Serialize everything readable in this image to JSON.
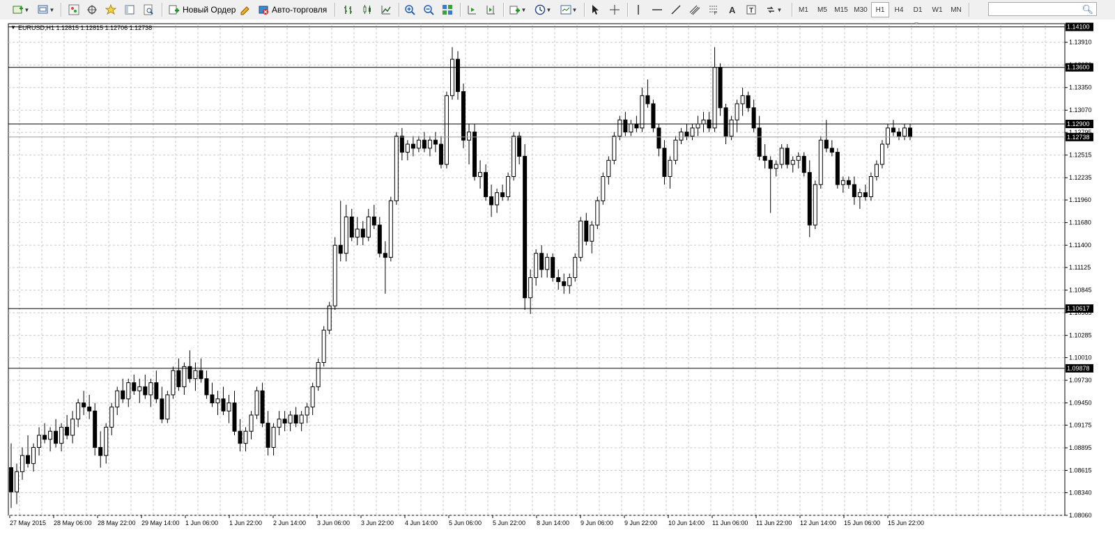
{
  "toolbar": {
    "new_order_label": "Новый Ордер",
    "auto_trading_label": "Авто-торговля",
    "timeframes": [
      "M1",
      "M5",
      "M15",
      "M30",
      "H1",
      "H4",
      "D1",
      "W1",
      "MN"
    ],
    "active_timeframe": "H1",
    "search_placeholder": ""
  },
  "chart_data": {
    "type": "candlestick",
    "symbol_header": "EURUSD,H1  1.12815 1.12815 1.12706 1.12738",
    "price_ticks": [
      "1.13910",
      "1.13630",
      "1.13350",
      "1.13070",
      "1.12795",
      "1.12515",
      "1.12235",
      "1.11960",
      "1.11680",
      "1.11400",
      "1.11125",
      "1.10845",
      "1.10565",
      "1.10285",
      "1.10010",
      "1.09730",
      "1.09450",
      "1.09175",
      "1.08895",
      "1.08615",
      "1.08340",
      "1.08060"
    ],
    "time_ticks": [
      "27 May 2015",
      "28 May 06:00",
      "28 May 22:00",
      "29 May 14:00",
      "1 Jun 06:00",
      "1 Jun 22:00",
      "2 Jun 14:00",
      "3 Jun 06:00",
      "3 Jun 22:00",
      "4 Jun 14:00",
      "5 Jun 06:00",
      "5 Jun 22:00",
      "8 Jun 14:00",
      "9 Jun 06:00",
      "9 Jun 22:00",
      "10 Jun 14:00",
      "11 Jun 06:00",
      "11 Jun 22:00",
      "12 Jun 14:00",
      "15 Jun 06:00",
      "15 Jun 22:00"
    ],
    "y_range": [
      1.0806,
      1.1414
    ],
    "levels": [
      {
        "price": 1.141,
        "label": "1.14100"
      },
      {
        "price": 1.136,
        "label": "1.13600"
      },
      {
        "price": 1.129,
        "label": "1.12900"
      },
      {
        "price": 1.10617,
        "label": "1.10617"
      },
      {
        "price": 1.09878,
        "label": "1.09878"
      }
    ],
    "current_price": {
      "price": 1.12738,
      "label": "1.12738"
    },
    "grid": true,
    "candles": [
      [
        1.0865,
        1.0895,
        1.0815,
        1.0835
      ],
      [
        1.0835,
        1.087,
        1.082,
        1.086
      ],
      [
        1.086,
        1.089,
        1.085,
        1.088
      ],
      [
        1.088,
        1.0905,
        1.0865,
        1.087
      ],
      [
        1.087,
        1.0895,
        1.086,
        1.089
      ],
      [
        1.089,
        1.0915,
        1.088,
        1.0905
      ],
      [
        1.0905,
        1.092,
        1.0895,
        1.09
      ],
      [
        1.09,
        1.0915,
        1.0885,
        1.091
      ],
      [
        1.091,
        1.0925,
        1.089,
        1.0895
      ],
      [
        1.0895,
        1.092,
        1.0885,
        1.0915
      ],
      [
        1.0915,
        1.093,
        1.09,
        1.0905
      ],
      [
        1.0905,
        1.0935,
        1.0895,
        1.0925
      ],
      [
        1.0925,
        1.095,
        1.0915,
        1.0945
      ],
      [
        1.0945,
        1.096,
        1.093,
        1.094
      ],
      [
        1.094,
        1.0955,
        1.0925,
        1.0935
      ],
      [
        1.0935,
        1.0945,
        1.088,
        1.089
      ],
      [
        1.089,
        1.091,
        1.0865,
        1.088
      ],
      [
        1.088,
        1.092,
        1.087,
        1.0915
      ],
      [
        1.0915,
        1.0945,
        1.0905,
        1.094
      ],
      [
        1.094,
        1.0965,
        1.093,
        1.096
      ],
      [
        1.096,
        1.0975,
        1.0945,
        1.095
      ],
      [
        1.095,
        1.0975,
        1.094,
        1.097
      ],
      [
        1.097,
        1.098,
        1.0955,
        1.096
      ],
      [
        1.096,
        1.0975,
        1.0945,
        1.0965
      ],
      [
        1.0965,
        1.098,
        1.095,
        1.0955
      ],
      [
        1.0955,
        1.0975,
        1.094,
        1.097
      ],
      [
        1.097,
        1.0985,
        1.0945,
        1.095
      ],
      [
        1.095,
        1.0965,
        1.092,
        1.0925
      ],
      [
        1.0925,
        1.096,
        1.092,
        1.0955
      ],
      [
        1.0955,
        1.099,
        1.095,
        1.0985
      ],
      [
        1.0985,
        1.1,
        1.096,
        1.0965
      ],
      [
        1.0965,
        1.0995,
        1.0955,
        1.099
      ],
      [
        1.099,
        1.101,
        1.097,
        1.0975
      ],
      [
        1.0975,
        1.0995,
        1.096,
        1.0985
      ],
      [
        1.0985,
        1.1,
        1.097,
        1.0975
      ],
      [
        1.0975,
        1.0985,
        1.095,
        1.0955
      ],
      [
        1.0955,
        1.097,
        1.094,
        1.0945
      ],
      [
        1.0945,
        1.096,
        1.093,
        1.095
      ],
      [
        1.095,
        1.0965,
        1.093,
        1.0935
      ],
      [
        1.0935,
        1.0955,
        1.092,
        1.0945
      ],
      [
        1.0945,
        1.096,
        1.0905,
        1.091
      ],
      [
        1.091,
        1.0925,
        1.0885,
        1.0895
      ],
      [
        1.0895,
        1.0915,
        1.0885,
        1.091
      ],
      [
        1.091,
        1.0935,
        1.09,
        1.093
      ],
      [
        1.093,
        1.0965,
        1.0925,
        1.096
      ],
      [
        1.096,
        1.097,
        1.0915,
        1.092
      ],
      [
        1.092,
        1.0935,
        1.088,
        1.089
      ],
      [
        1.089,
        1.092,
        1.088,
        1.0915
      ],
      [
        1.0915,
        1.0935,
        1.0905,
        1.0925
      ],
      [
        1.0925,
        1.0935,
        1.091,
        1.092
      ],
      [
        1.092,
        1.0935,
        1.091,
        1.093
      ],
      [
        1.093,
        1.094,
        1.0915,
        1.092
      ],
      [
        1.092,
        1.0935,
        1.091,
        1.093
      ],
      [
        1.093,
        1.0945,
        1.092,
        1.094
      ],
      [
        1.094,
        1.097,
        1.093,
        1.0965
      ],
      [
        1.0965,
        1.1,
        1.096,
        1.0995
      ],
      [
        1.0995,
        1.104,
        1.099,
        1.1035
      ],
      [
        1.1035,
        1.107,
        1.103,
        1.1065
      ],
      [
        1.1065,
        1.115,
        1.106,
        1.114
      ],
      [
        1.114,
        1.1195,
        1.112,
        1.113
      ],
      [
        1.113,
        1.119,
        1.112,
        1.1175
      ],
      [
        1.1175,
        1.1185,
        1.1145,
        1.115
      ],
      [
        1.115,
        1.1175,
        1.114,
        1.116
      ],
      [
        1.116,
        1.117,
        1.114,
        1.115
      ],
      [
        1.115,
        1.1185,
        1.1145,
        1.1175
      ],
      [
        1.1175,
        1.119,
        1.116,
        1.1165
      ],
      [
        1.1165,
        1.1175,
        1.1125,
        1.113
      ],
      [
        1.113,
        1.1145,
        1.108,
        1.1125
      ],
      [
        1.1125,
        1.12,
        1.112,
        1.1195
      ],
      [
        1.1195,
        1.128,
        1.119,
        1.1275
      ],
      [
        1.1275,
        1.1285,
        1.1245,
        1.1255
      ],
      [
        1.1255,
        1.127,
        1.1245,
        1.1265
      ],
      [
        1.1265,
        1.1275,
        1.125,
        1.126
      ],
      [
        1.126,
        1.1275,
        1.1255,
        1.127
      ],
      [
        1.127,
        1.128,
        1.1255,
        1.126
      ],
      [
        1.126,
        1.1275,
        1.125,
        1.127
      ],
      [
        1.127,
        1.128,
        1.1255,
        1.1265
      ],
      [
        1.1265,
        1.1275,
        1.1235,
        1.124
      ],
      [
        1.124,
        1.133,
        1.1235,
        1.1325
      ],
      [
        1.1325,
        1.1385,
        1.132,
        1.137
      ],
      [
        1.137,
        1.138,
        1.132,
        1.133
      ],
      [
        1.133,
        1.134,
        1.126,
        1.127
      ],
      [
        1.127,
        1.129,
        1.124,
        1.128
      ],
      [
        1.128,
        1.129,
        1.122,
        1.1225
      ],
      [
        1.1225,
        1.1245,
        1.121,
        1.123
      ],
      [
        1.123,
        1.124,
        1.1195,
        1.12
      ],
      [
        1.12,
        1.1215,
        1.1175,
        1.119
      ],
      [
        1.119,
        1.121,
        1.118,
        1.1205
      ],
      [
        1.1205,
        1.1215,
        1.1195,
        1.12
      ],
      [
        1.12,
        1.123,
        1.1195,
        1.1225
      ],
      [
        1.1225,
        1.128,
        1.122,
        1.1275
      ],
      [
        1.1275,
        1.128,
        1.124,
        1.125
      ],
      [
        1.125,
        1.1265,
        1.106,
        1.1075
      ],
      [
        1.1075,
        1.111,
        1.1055,
        1.11
      ],
      [
        1.11,
        1.1135,
        1.109,
        1.113
      ],
      [
        1.113,
        1.114,
        1.11,
        1.111
      ],
      [
        1.111,
        1.113,
        1.11,
        1.1125
      ],
      [
        1.1125,
        1.113,
        1.1095,
        1.11
      ],
      [
        1.11,
        1.111,
        1.1085,
        1.1095
      ],
      [
        1.1095,
        1.1105,
        1.108,
        1.109
      ],
      [
        1.109,
        1.1105,
        1.108,
        1.11
      ],
      [
        1.11,
        1.113,
        1.1095,
        1.1125
      ],
      [
        1.1125,
        1.1175,
        1.112,
        1.117
      ],
      [
        1.117,
        1.118,
        1.114,
        1.1145
      ],
      [
        1.1145,
        1.117,
        1.113,
        1.1165
      ],
      [
        1.1165,
        1.12,
        1.116,
        1.1195
      ],
      [
        1.1195,
        1.123,
        1.119,
        1.1225
      ],
      [
        1.1225,
        1.125,
        1.1215,
        1.1245
      ],
      [
        1.1245,
        1.128,
        1.124,
        1.1275
      ],
      [
        1.1275,
        1.13,
        1.127,
        1.1295
      ],
      [
        1.1295,
        1.1305,
        1.1275,
        1.128
      ],
      [
        1.128,
        1.1295,
        1.1275,
        1.129
      ],
      [
        1.129,
        1.13,
        1.128,
        1.1285
      ],
      [
        1.1285,
        1.1335,
        1.128,
        1.1325
      ],
      [
        1.1325,
        1.1345,
        1.131,
        1.1315
      ],
      [
        1.1315,
        1.132,
        1.128,
        1.1285
      ],
      [
        1.1285,
        1.129,
        1.125,
        1.126
      ],
      [
        1.126,
        1.127,
        1.1215,
        1.1225
      ],
      [
        1.1225,
        1.125,
        1.121,
        1.1245
      ],
      [
        1.1245,
        1.1275,
        1.124,
        1.127
      ],
      [
        1.127,
        1.1285,
        1.1265,
        1.128
      ],
      [
        1.128,
        1.129,
        1.127,
        1.1275
      ],
      [
        1.1275,
        1.129,
        1.127,
        1.1285
      ],
      [
        1.1285,
        1.13,
        1.1275,
        1.129
      ],
      [
        1.129,
        1.1305,
        1.128,
        1.1295
      ],
      [
        1.1295,
        1.1305,
        1.128,
        1.1285
      ],
      [
        1.1285,
        1.1385,
        1.128,
        1.136
      ],
      [
        1.136,
        1.1365,
        1.13,
        1.131
      ],
      [
        1.131,
        1.1315,
        1.1265,
        1.1275
      ],
      [
        1.1275,
        1.13,
        1.127,
        1.1295
      ],
      [
        1.1295,
        1.132,
        1.128,
        1.1315
      ],
      [
        1.1315,
        1.1335,
        1.13,
        1.1325
      ],
      [
        1.1325,
        1.133,
        1.1305,
        1.131
      ],
      [
        1.131,
        1.132,
        1.128,
        1.1285
      ],
      [
        1.1285,
        1.13,
        1.1245,
        1.125
      ],
      [
        1.125,
        1.1265,
        1.1235,
        1.1245
      ],
      [
        1.1245,
        1.125,
        1.118,
        1.1235
      ],
      [
        1.1235,
        1.1245,
        1.1225,
        1.124
      ],
      [
        1.124,
        1.1265,
        1.1235,
        1.126
      ],
      [
        1.126,
        1.1265,
        1.1235,
        1.124
      ],
      [
        1.124,
        1.125,
        1.123,
        1.1245
      ],
      [
        1.1245,
        1.1255,
        1.1235,
        1.125
      ],
      [
        1.125,
        1.1255,
        1.1225,
        1.123
      ],
      [
        1.123,
        1.1245,
        1.115,
        1.1165
      ],
      [
        1.1165,
        1.122,
        1.116,
        1.1215
      ],
      [
        1.1215,
        1.1275,
        1.121,
        1.127
      ],
      [
        1.127,
        1.1295,
        1.1255,
        1.126
      ],
      [
        1.126,
        1.127,
        1.125,
        1.1255
      ],
      [
        1.1255,
        1.126,
        1.121,
        1.1215
      ],
      [
        1.1215,
        1.1225,
        1.1205,
        1.122
      ],
      [
        1.122,
        1.1225,
        1.121,
        1.1215
      ],
      [
        1.1215,
        1.1225,
        1.119,
        1.12
      ],
      [
        1.12,
        1.121,
        1.1185,
        1.1205
      ],
      [
        1.1205,
        1.1215,
        1.1195,
        1.12
      ],
      [
        1.12,
        1.123,
        1.1195,
        1.1225
      ],
      [
        1.1225,
        1.1245,
        1.122,
        1.124
      ],
      [
        1.124,
        1.127,
        1.1235,
        1.1265
      ],
      [
        1.1265,
        1.129,
        1.126,
        1.1285
      ],
      [
        1.1285,
        1.1295,
        1.1275,
        1.128
      ],
      [
        1.128,
        1.1285,
        1.127,
        1.1275
      ],
      [
        1.1275,
        1.129,
        1.127,
        1.1285
      ],
      [
        1.1285,
        1.129,
        1.127,
        1.1274
      ]
    ]
  }
}
